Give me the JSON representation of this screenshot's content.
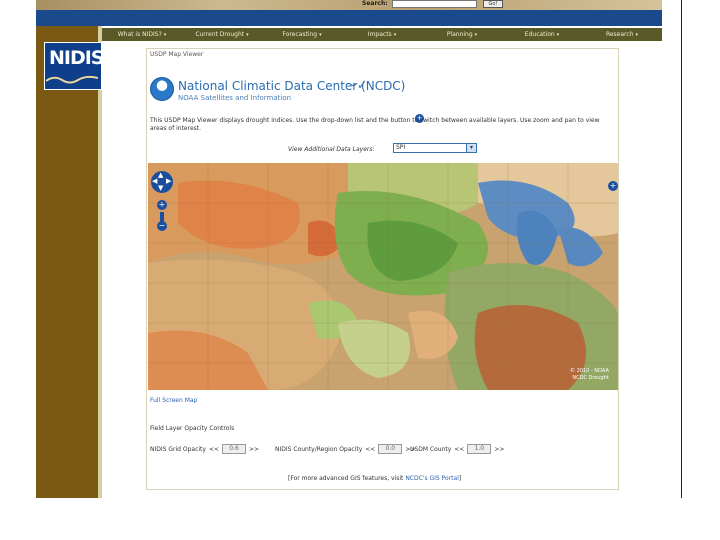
{
  "header": {
    "search_label": "Search:",
    "go_label": "Go!"
  },
  "nav": {
    "items": [
      {
        "label": "What is NIDIS?"
      },
      {
        "label": "Current Drought"
      },
      {
        "label": "Forecasting"
      },
      {
        "label": "Impacts"
      },
      {
        "label": "Planning"
      },
      {
        "label": "Education"
      },
      {
        "label": "Research"
      }
    ]
  },
  "logo": {
    "text": "NIDIS"
  },
  "viewer": {
    "title": "USDP Map Viewer",
    "org_title": "National Climatic Data Center (NCDC)",
    "org_subtitle": "NOAA Satellites and Information",
    "intro_text": "This USDP Map Viewer displays drought indices. Use the drop-down list and the button to switch between available layers. Use zoom and pan to view areas of interest.",
    "info_icon": "+",
    "layer_label": "View Additional Data Layers: ",
    "layer_selected": "SPI"
  },
  "map": {
    "credit_line1": "© 2010 - NOAA",
    "credit_line2": "NCDC Drought"
  },
  "footnote": {
    "link": "Full Screen Map"
  },
  "opacity": {
    "title": "Field Layer Opacity Controls",
    "groups": [
      {
        "label": "NIDIS Grid Opacity",
        "value": "0.6"
      },
      {
        "label": "NIDIS County/Region Opacity",
        "value": "0.0"
      },
      {
        "label": "USDM County",
        "value": "1.0"
      }
    ]
  },
  "footer": {
    "prefix": "[For more advanced GIS features, visit ",
    "link": "NCDC's GIS Portal",
    "suffix": "]"
  },
  "colors": {
    "nav_bg": "#5a5a28",
    "left_col": "#7a5a12",
    "banner_blue": "#1a4a8c",
    "accent_blue": "#2b6cb0"
  }
}
